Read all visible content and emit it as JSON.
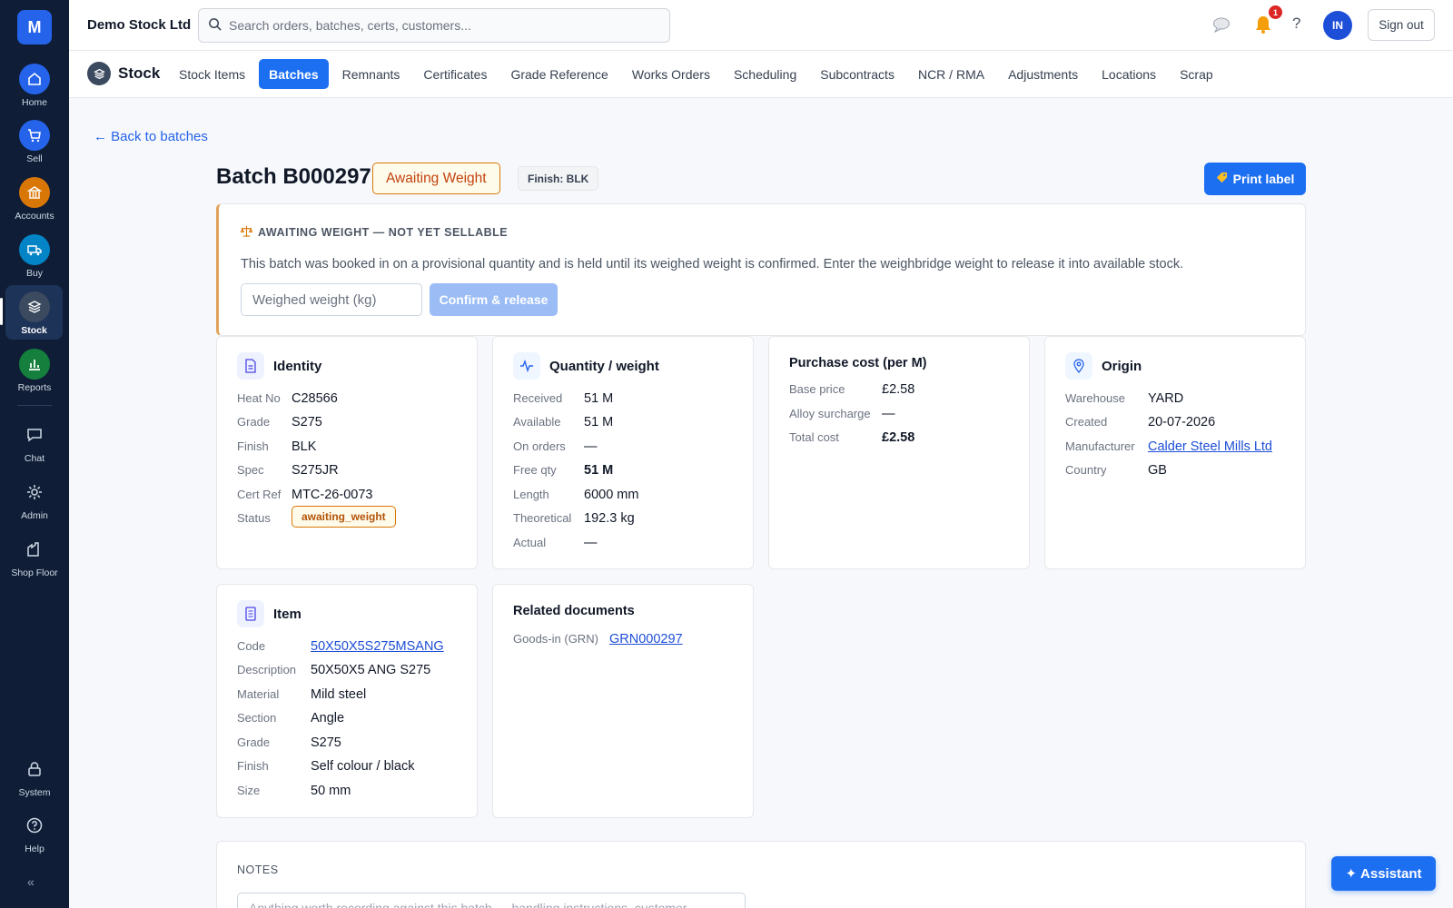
{
  "sidebar": {
    "logo": "M",
    "items": [
      {
        "label": "Home",
        "color": "#2563eb"
      },
      {
        "label": "Sell",
        "color": "#2563eb"
      },
      {
        "label": "Accounts",
        "color": "#d97706"
      },
      {
        "label": "Buy",
        "color": "#0284c7"
      },
      {
        "label": "Stock",
        "color": "#3b4a5f"
      },
      {
        "label": "Reports",
        "color": "#15803d"
      },
      {
        "label": "Chat"
      },
      {
        "label": "Admin"
      },
      {
        "label": "Shop Floor"
      },
      {
        "label": "System"
      },
      {
        "label": "Help"
      }
    ],
    "collapse": "«"
  },
  "topbar": {
    "company": "Demo Stock Ltd",
    "search_placeholder": "Search orders, batches, certs, customers...",
    "notifications_count": "1",
    "help": "?",
    "avatar": "IN",
    "signout": "Sign out"
  },
  "module": {
    "title": "Stock",
    "tabs": [
      "Stock Items",
      "Batches",
      "Remnants",
      "Certificates",
      "Grade Reference",
      "Works Orders",
      "Scheduling",
      "Subcontracts",
      "NCR / RMA",
      "Adjustments",
      "Locations",
      "Scrap"
    ],
    "active_tab": "Batches"
  },
  "page": {
    "back": "← Back to batches",
    "title": "Batch B000297",
    "status": "Awaiting Weight",
    "finish": "Finish: BLK",
    "print": "Print label"
  },
  "alert": {
    "heading": "AWAITING WEIGHT — NOT YET SELLABLE",
    "text": "This batch was booked in on a provisional quantity and is held until its weighed weight is confirmed. Enter the weighbridge weight to release it into available stock.",
    "input_placeholder": "Weighed weight (kg)",
    "confirm": "Confirm & release"
  },
  "identity": {
    "title": "Identity",
    "rows": [
      {
        "k": "Heat No",
        "v": "C28566"
      },
      {
        "k": "Grade",
        "v": "S275"
      },
      {
        "k": "Finish",
        "v": "BLK"
      },
      {
        "k": "Spec",
        "v": "S275JR"
      },
      {
        "k": "Cert Ref",
        "v": "MTC-26-0073"
      },
      {
        "k": "Status",
        "v": "awaiting_weight"
      }
    ]
  },
  "quantity": {
    "title": "Quantity / weight",
    "rows": [
      {
        "k": "Received",
        "v": "51 M"
      },
      {
        "k": "Available",
        "v": "51 M"
      },
      {
        "k": "On orders",
        "v": "—"
      },
      {
        "k": "Free qty",
        "v": "51 M"
      },
      {
        "k": "Length",
        "v": "6000 mm"
      },
      {
        "k": "Theoretical",
        "v": "192.3 kg"
      },
      {
        "k": "Actual",
        "v": "—"
      }
    ]
  },
  "cost": {
    "title": "Purchase cost (per M)",
    "rows": [
      {
        "k": "Base price",
        "v": "£2.58"
      },
      {
        "k": "Alloy surcharge",
        "v": "—"
      },
      {
        "k": "Total cost",
        "v": "£2.58"
      }
    ]
  },
  "origin": {
    "title": "Origin",
    "rows": [
      {
        "k": "Warehouse",
        "v": "YARD"
      },
      {
        "k": "Created",
        "v": "20-07-2026"
      },
      {
        "k": "Manufacturer",
        "v": "Calder Steel Mills Ltd"
      },
      {
        "k": "Country",
        "v": "GB"
      }
    ]
  },
  "item": {
    "title": "Item",
    "rows": [
      {
        "k": "Code",
        "v": "50X50X5S275MSANG"
      },
      {
        "k": "Description",
        "v": "50X50X5 ANG S275"
      },
      {
        "k": "Material",
        "v": "Mild steel"
      },
      {
        "k": "Section",
        "v": "Angle"
      },
      {
        "k": "Grade",
        "v": "S275"
      },
      {
        "k": "Finish",
        "v": "Self colour / black"
      },
      {
        "k": "Size",
        "v": "50 mm"
      }
    ]
  },
  "related": {
    "title": "Related documents",
    "rows": [
      {
        "k": "Goods-in (GRN)",
        "v": "GRN000297"
      }
    ]
  },
  "notes": {
    "label": "NOTES",
    "placeholder": "Anything worth recording against this batch — handling instructions, customer..."
  },
  "assistant": "Assistant"
}
